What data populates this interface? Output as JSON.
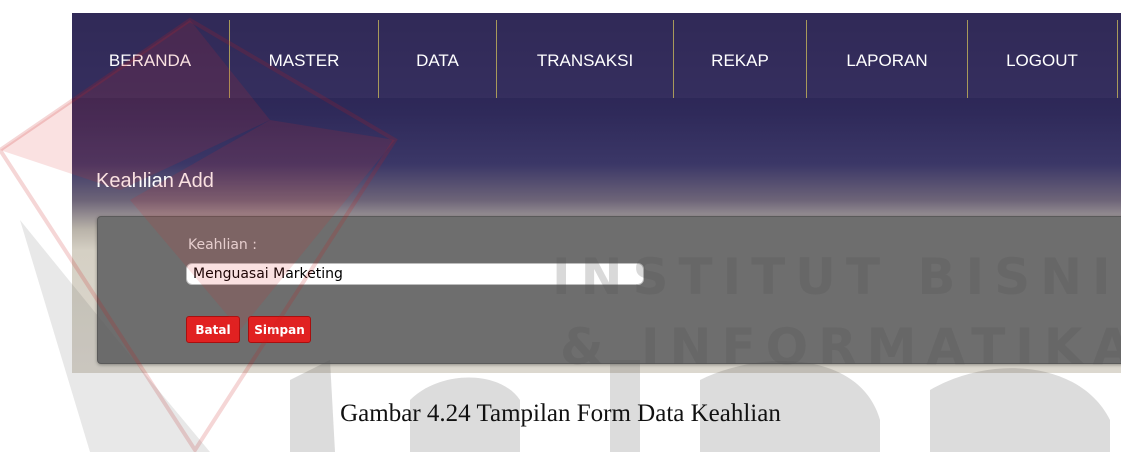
{
  "nav": {
    "items": [
      {
        "label": "BERANDA"
      },
      {
        "label": "MASTER"
      },
      {
        "label": "DATA"
      },
      {
        "label": "TRANSAKSI"
      },
      {
        "label": "REKAP"
      },
      {
        "label": "LAPORAN"
      },
      {
        "label": "LOGOUT"
      }
    ]
  },
  "page": {
    "title": "Keahlian Add"
  },
  "form": {
    "keahlian_label": "Keahlian :",
    "keahlian_value": "Menguasai Marketing",
    "batal_label": "Batal",
    "simpan_label": "Simpan"
  },
  "watermark": {
    "line1": "INSTITUT BISNIS",
    "line2": "& INFORMATIKA",
    "brand": "stikom"
  },
  "caption": "Gambar 4.24 Tampilan Form Data Keahlian",
  "colors": {
    "accent_red": "#e12121",
    "nav_bg": "#2f2a5a"
  }
}
